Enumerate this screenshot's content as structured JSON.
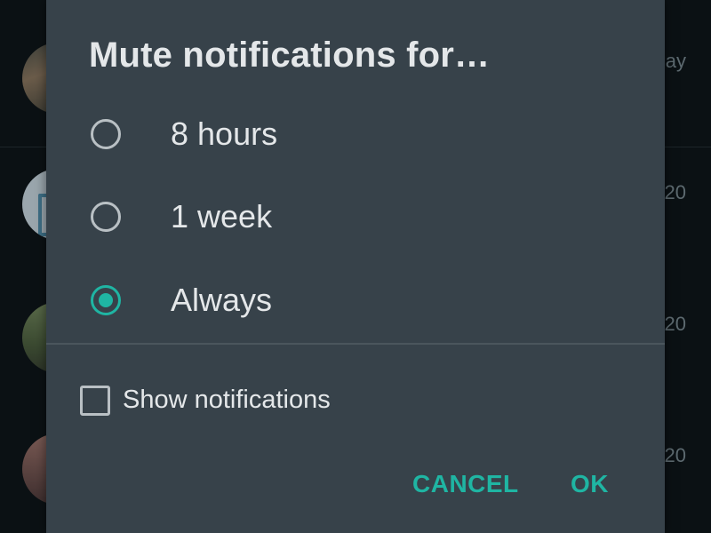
{
  "background_list": {
    "rows": [
      {
        "time": "ay"
      },
      {
        "time": "20"
      },
      {
        "time": "20"
      },
      {
        "time": "20"
      }
    ]
  },
  "dialog": {
    "title": "Mute notifications for…",
    "options": [
      {
        "label": "8 hours",
        "selected": false
      },
      {
        "label": "1 week",
        "selected": false
      },
      {
        "label": "Always",
        "selected": true
      }
    ],
    "show_notifications": {
      "label": "Show notifications",
      "checked": false
    },
    "buttons": {
      "cancel": "CANCEL",
      "ok": "OK"
    }
  },
  "colors": {
    "accent": "#1fb5a3",
    "dialog_bg": "#37424a",
    "text": "#e4e7e9",
    "control_border": "#b9c0c4"
  }
}
